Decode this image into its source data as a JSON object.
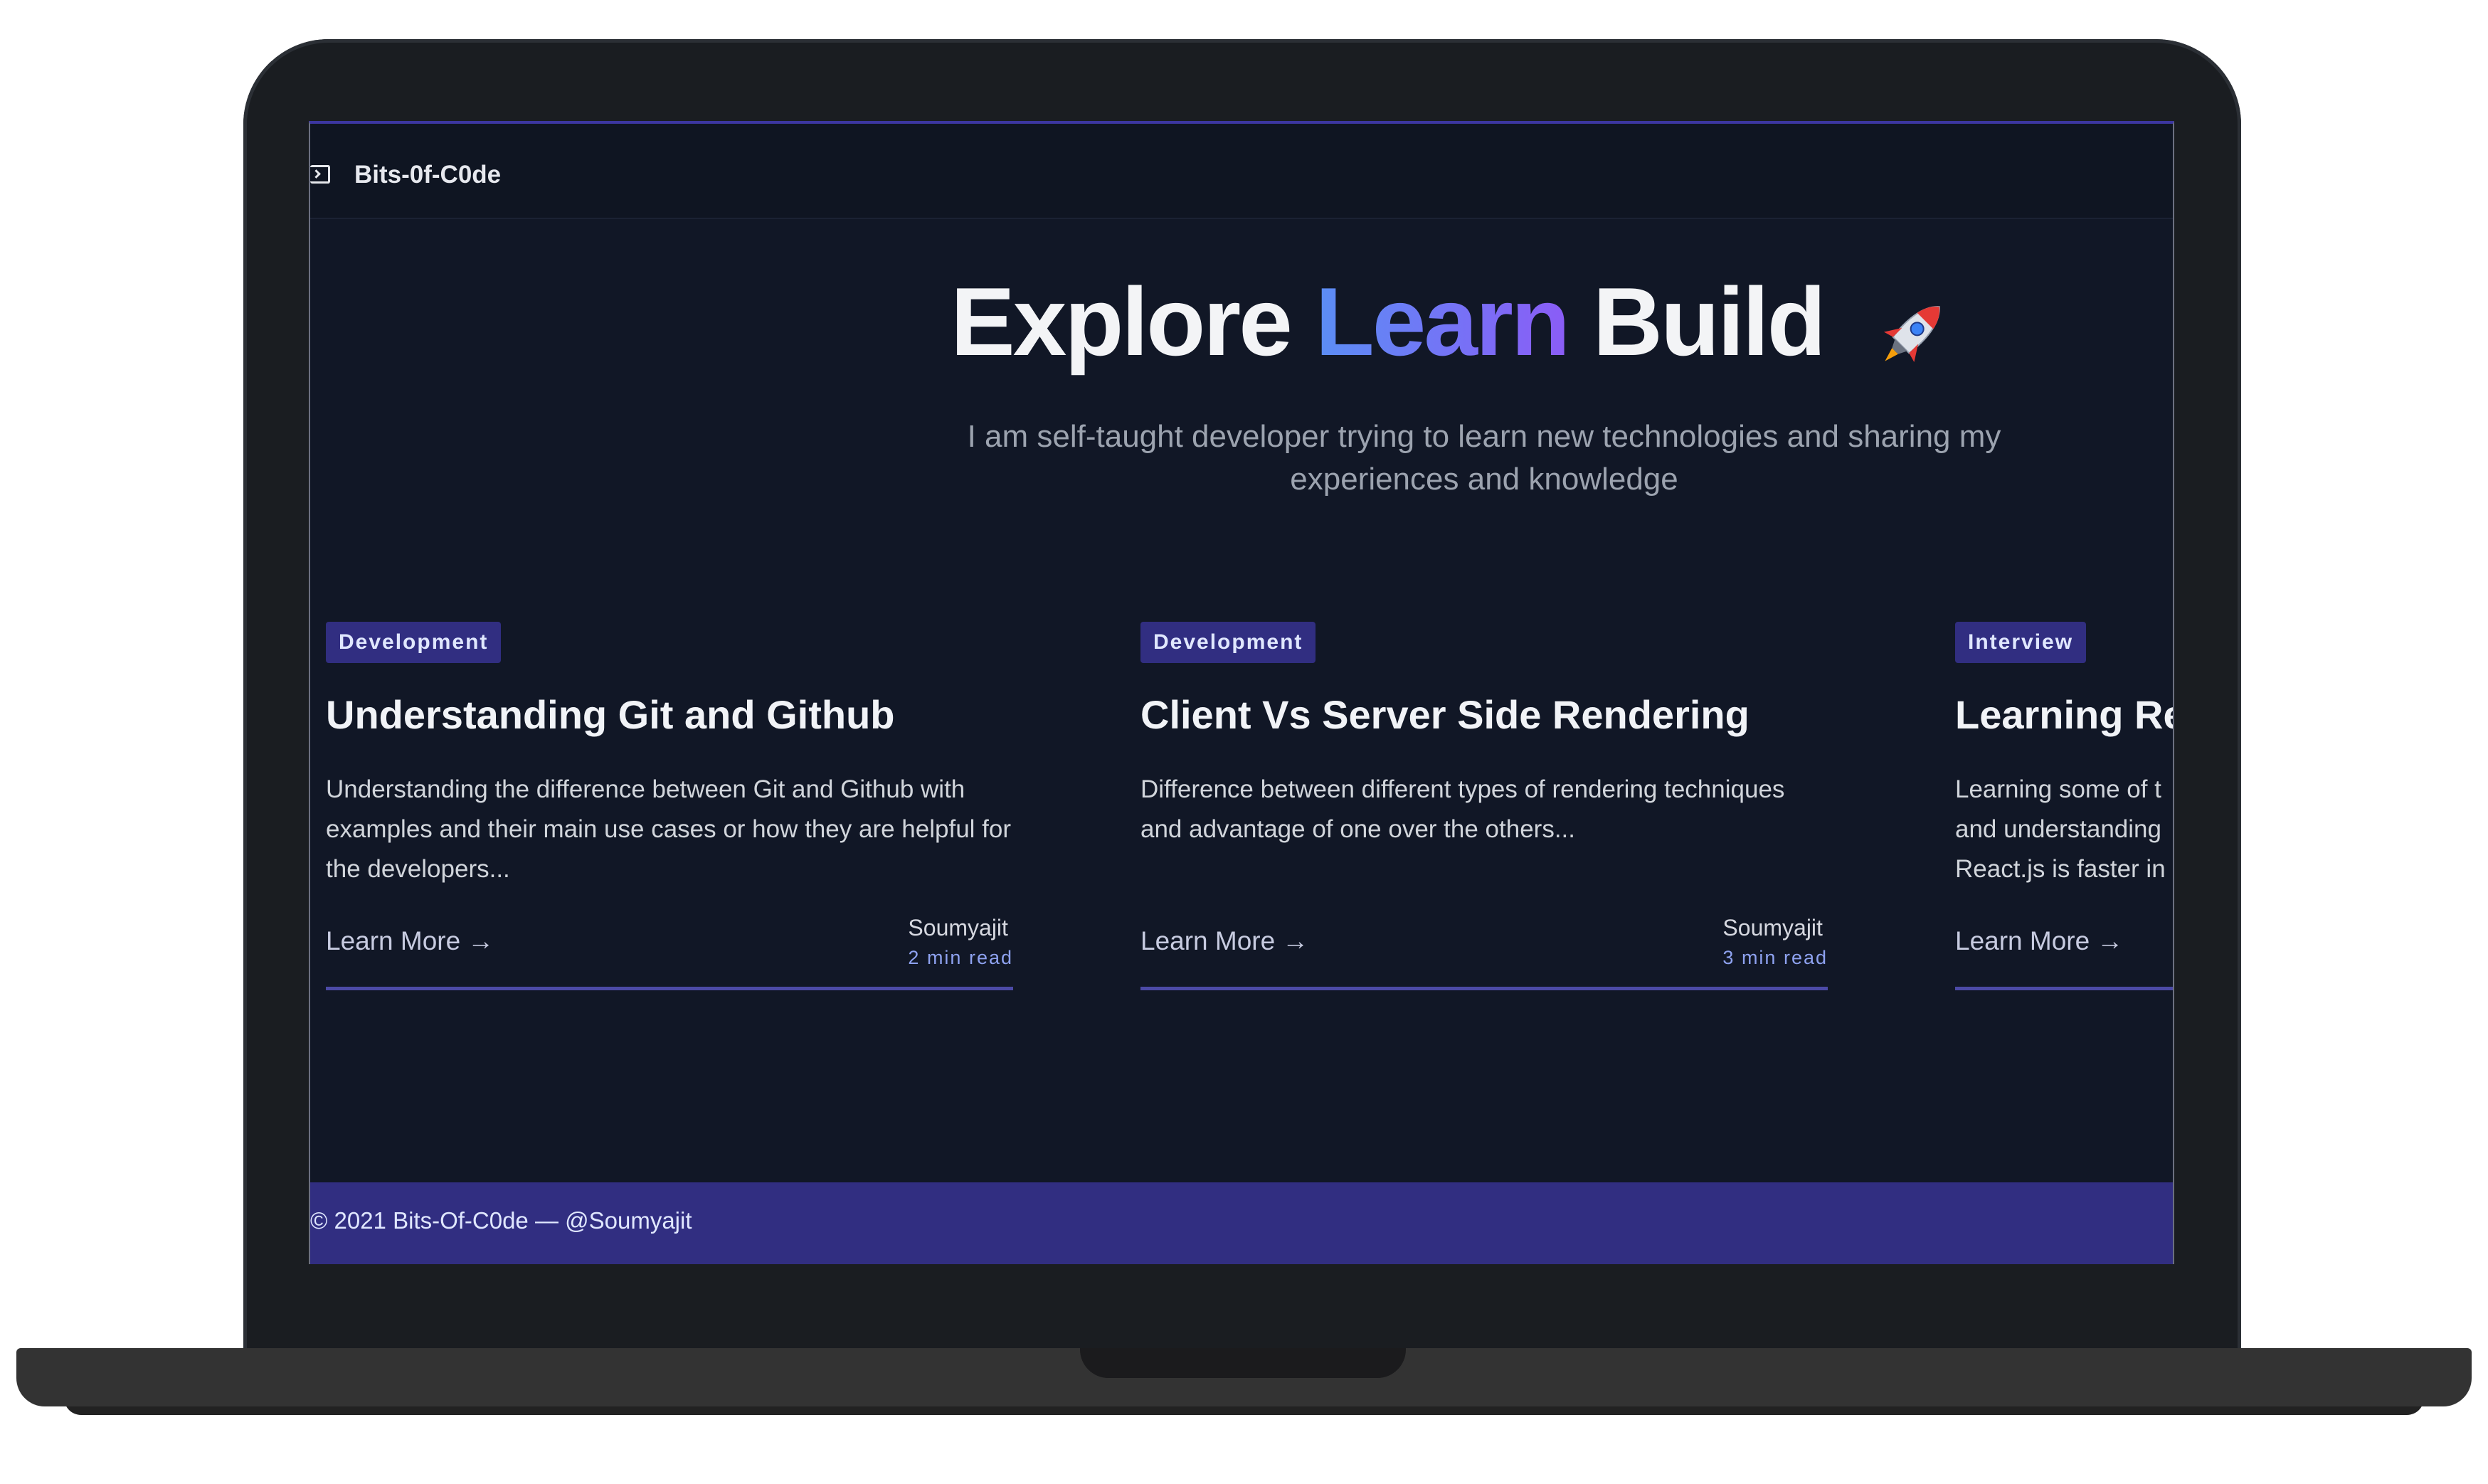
{
  "brand": {
    "name": "Bits-0f-C0de"
  },
  "hero": {
    "title_part1": "Explore",
    "title_part2": "Learn",
    "title_part3": "Build",
    "subtitle": "I am self-taught developer trying to learn new technologies and sharing my experiences and knowledge"
  },
  "cards": [
    {
      "tag": "Development",
      "title": "Understanding Git and Github",
      "description": "Understanding the difference between Git and Github with examples and their main use cases or how they are helpful for the developers...",
      "link_label": "Learn More",
      "author": "Soumyajit",
      "read_time": "2 min read"
    },
    {
      "tag": "Development",
      "title": "Client Vs Server Side Rendering",
      "description": "Difference between different types of rendering techniques and advantage of one over the others...",
      "link_label": "Learn More",
      "author": "Soumyajit",
      "read_time": "3 min read"
    },
    {
      "tag": "Interview",
      "title": "Learning Re",
      "description": "Learning some of t and understanding React.js is faster in",
      "link_label": "Learn More"
    }
  ],
  "footer": {
    "text": "© 2021 Bits-Of-C0de — @Soumyajit"
  },
  "colors": {
    "background": "#111726",
    "accent_gradient_start": "#5b8ef5",
    "accent_gradient_end": "#8b5cf6",
    "tag_bg": "#312e81",
    "footer_bg": "#312e81"
  },
  "icons": {
    "brand_icon": "terminal-icon",
    "hero_icon": "rocket-icon",
    "link_icon": "arrow-right-icon"
  }
}
